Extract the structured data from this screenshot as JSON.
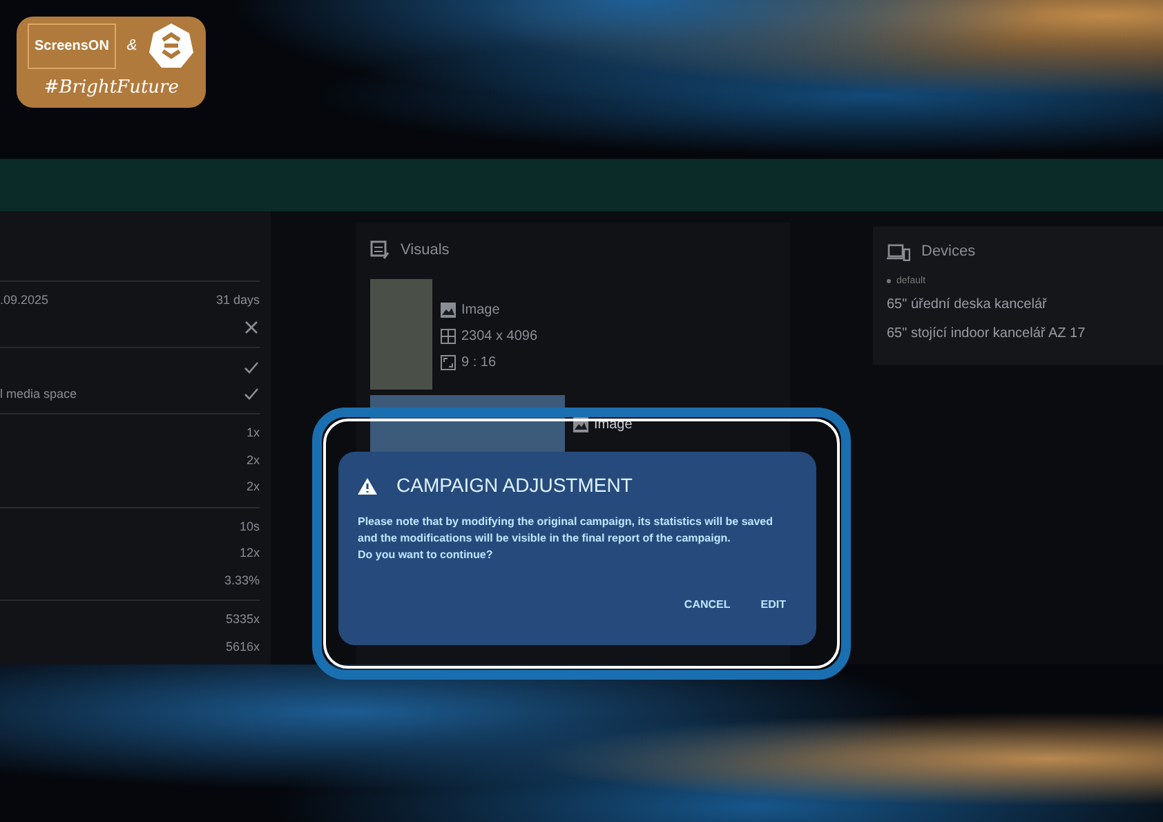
{
  "logo": {
    "name": "ScreensON",
    "conjunction": "&",
    "hashtag": "#BrightFuture"
  },
  "summary_panel": {
    "groups": [
      {
        "rows": [
          {
            "kind": "text",
            "label": ".09.2025",
            "value": "31 days"
          },
          {
            "kind": "status",
            "checked": false
          }
        ]
      },
      {
        "rows": [
          {
            "kind": "status",
            "checked": true
          },
          {
            "kind": "status",
            "label": "l media space",
            "checked": true
          }
        ]
      },
      {
        "rows": [
          {
            "kind": "text",
            "value": "1x"
          },
          {
            "kind": "text",
            "value": "2x"
          },
          {
            "kind": "text",
            "value": "2x"
          }
        ]
      },
      {
        "rows": [
          {
            "kind": "text",
            "value": "10s"
          },
          {
            "kind": "text",
            "value": "12x"
          },
          {
            "kind": "text",
            "value": "3.33%"
          }
        ]
      },
      {
        "rows": [
          {
            "kind": "text",
            "value": "5335x"
          },
          {
            "kind": "text",
            "value": "5616x"
          }
        ]
      }
    ]
  },
  "visuals": {
    "title": "Visuals",
    "items": [
      {
        "type": "Image",
        "resolution": "2304 x 4096",
        "ratio": "9 : 16"
      },
      {
        "type": "Image"
      }
    ]
  },
  "devices": {
    "title": "Devices",
    "group": "default",
    "items": [
      "65\" úřední deska kancelář",
      "65\" stojící indoor kancelář AZ 17"
    ]
  },
  "dialog": {
    "title": "CAMPAIGN ADJUSTMENT",
    "message": "Please note that by modifying the original campaign, its statistics will be saved\nand the modifications will be visible in the final report of the campaign.\nDo you want to continue?",
    "buttons": [
      "CANCEL",
      "EDIT"
    ]
  }
}
